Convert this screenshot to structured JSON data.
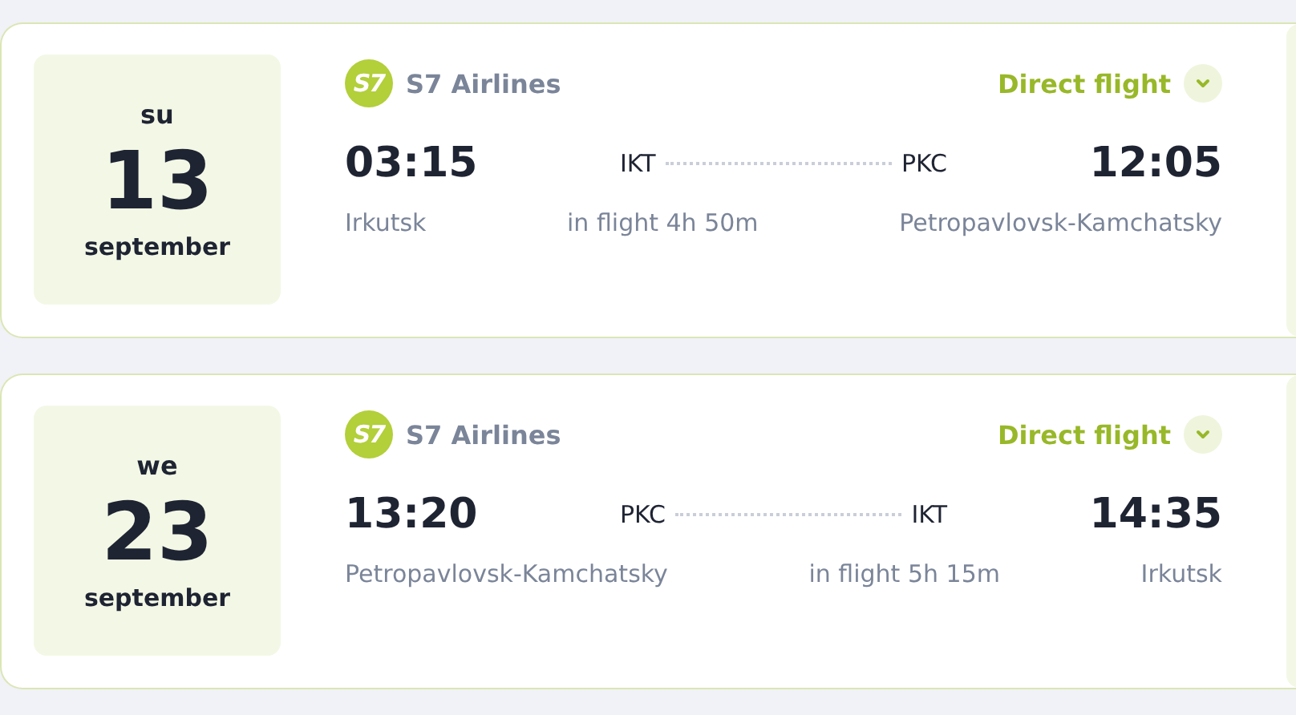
{
  "flights": [
    {
      "date": {
        "weekday": "su",
        "day": "13",
        "month": "september"
      },
      "airline": {
        "logo_text": "S7",
        "name": "S7 Airlines"
      },
      "flight_type": "Direct flight",
      "expanded": false,
      "departure": {
        "time": "03:15",
        "code": "IKT",
        "city": "Irkutsk"
      },
      "arrival": {
        "time": "12:05",
        "code": "PKC",
        "city": "Petropavlovsk-Kamchatsky"
      },
      "duration": "in flight 4h 50m"
    },
    {
      "date": {
        "weekday": "we",
        "day": "23",
        "month": "september"
      },
      "airline": {
        "logo_text": "S7",
        "name": "S7 Airlines"
      },
      "flight_type": "Direct flight",
      "expanded": false,
      "departure": {
        "time": "13:20",
        "code": "PKC",
        "city": "Petropavlovsk-Kamchatsky"
      },
      "arrival": {
        "time": "14:35",
        "code": "IKT",
        "city": "Irkutsk"
      },
      "duration": "in flight 5h 15m"
    }
  ]
}
